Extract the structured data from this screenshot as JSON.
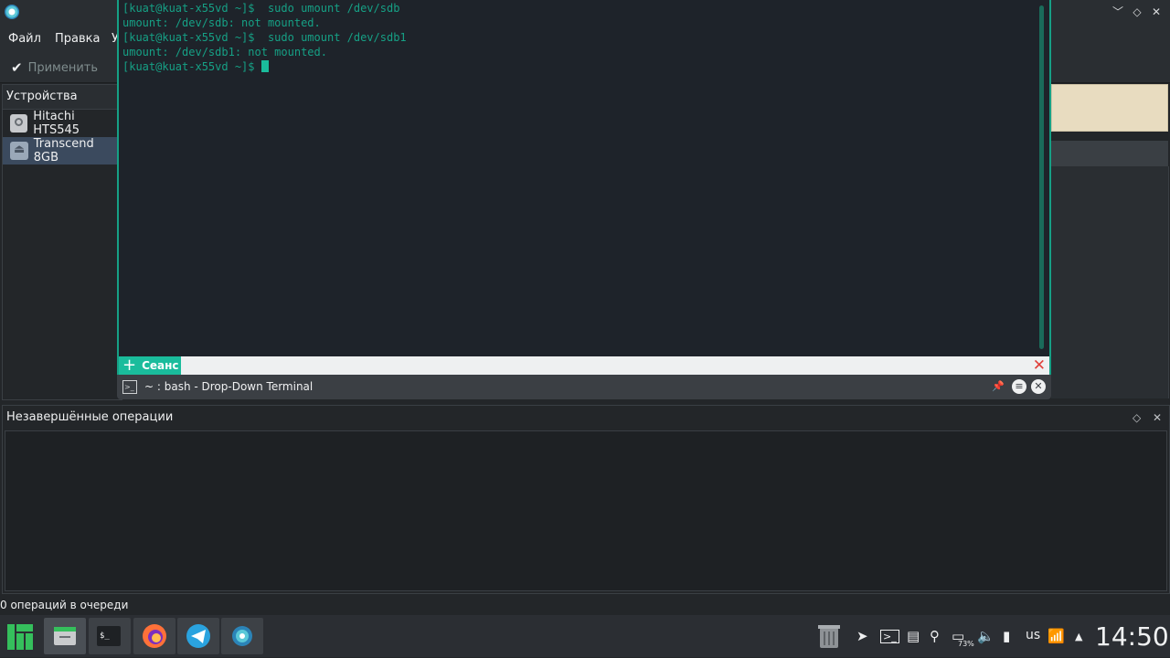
{
  "window": {
    "menu": [
      "Файл",
      "Правка",
      "У"
    ],
    "toolbar": {
      "apply_label": "Применить"
    },
    "devices": {
      "header": "Устройства",
      "items": [
        {
          "label": "Hitachi HTS545",
          "icon": "hard-disk-icon"
        },
        {
          "label": "Transcend 8GB",
          "icon": "usb-drive-icon",
          "selected": true
        }
      ]
    },
    "pending": {
      "header": "Незавершённые операции"
    },
    "status": "0 операций в очереди"
  },
  "terminal": {
    "lines": [
      "[kuat@kuat-x55vd ~]$  sudo umount /dev/sdb",
      "umount: /dev/sdb: not mounted.",
      "[kuat@kuat-x55vd ~]$  sudo umount /dev/sdb1",
      "umount: /dev/sdb1: not mounted.",
      "[kuat@kuat-x55vd ~]$ "
    ],
    "tab_label": "Сеанс",
    "title": "~ : bash - Drop-Down Terminal",
    "accent": "#16a085"
  },
  "taskbar": {
    "tasks": [
      "manjaro-menu-icon",
      "file-manager-icon",
      "terminal-icon",
      "firefox-icon",
      "telegram-icon",
      "partition-manager-icon"
    ],
    "tray": {
      "battery_percent": "73%",
      "keyboard_layout": "us"
    },
    "clock": "14:50"
  }
}
